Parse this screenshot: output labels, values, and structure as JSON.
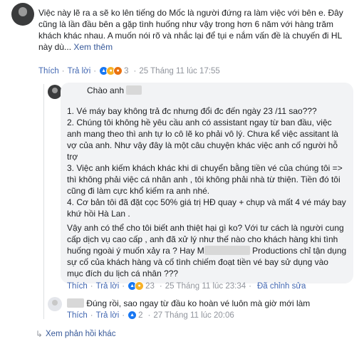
{
  "comment1": {
    "lines": [
      "Việc này lẽ ra a sẽ ko lên tiếng do Mốc là người đứng ra làm việc với bên e. Đây",
      "cũng là lần đầu bên a gặp tình huống như vậy trong hơn 6 năm với hàng trăm",
      "khách khác nhau. A muốn nói rõ và nhắc lại để tụi e nắm vấn đề là chuyến đi HL",
      "này dù..."
    ],
    "see_more": "Xem thêm",
    "like": "Thích",
    "reply": "Trả lời",
    "reaction_count": "3",
    "timestamp": "25 Tháng 11 lúc 17:55"
  },
  "comment2": {
    "greeting": "Chào anh",
    "paragraphs": [
      [
        "1. Vé máy bay không trả đc nhưng đổi đc đến ngày 23 /11 sao???"
      ],
      [
        "2. Chúng tôi không hề yêu cầu anh có assistant ngay từ ban đầu, việc",
        "anh mang theo thì anh tự lo cô lẽ ko phải vô lý. Chưa kể việc assitant là",
        "vợ của anh. Như vậy đây là một câu chuyện khác việc anh cố người hỗ",
        "trợ"
      ],
      [
        "3. Việc anh kiếm khách khác khi di chuyển bằng tiền vé của chúng tôi =>",
        "thì không phải việc cá nhân anh , tôi không phải nhà từ thiện. Tiền đó tôi",
        "cũng đi làm cực khổ kiếm ra anh nhé."
      ],
      [
        "4. Cơ bản tôi đã đặt cọc 50% giá trị HĐ quay + chụp và mất 4 vé máy bay",
        "khứ hồi Hà Lan ."
      ]
    ],
    "closing": [
      "Vậy anh có thể cho tôi biết anh thiệt hại gì ko? Với tư cách là người cung",
      "cấp dịch vụ cao cấp , anh đã xử lý như thế nào cho khách hàng khi tình",
      "huống ngoài ý muốn xảy ra ? Hay M",
      " Productions chỉ tận dụng",
      "sự cố của khách hàng và cố tình chiếm đoạt tiền vé bay sử dụng vào",
      "mục đích du lịch cá nhân ???"
    ],
    "like": "Thích",
    "reply": "Trả lời",
    "reaction_count": "23",
    "timestamp": "25 Tháng 11 lúc 23:34",
    "edited": "Đã chỉnh sửa"
  },
  "comment3": {
    "text": "Đúng rồi, sao ngay từ đầu ko hoàn vé luôn mà giờ mới làm",
    "like": "Thích",
    "reply": "Trả lời",
    "reaction_count": "2",
    "timestamp": "27 Tháng 11 lúc 20:06"
  },
  "more_replies": "Xem phản hồi khác",
  "colors": {
    "link": "#4267b2",
    "name": "#365899",
    "muted": "#90949c",
    "bubble": "#f2f3f5"
  },
  "icons": [
    "like-icon",
    "haha-icon",
    "angry-icon",
    "reply-arrow-icon",
    "avatar"
  ]
}
